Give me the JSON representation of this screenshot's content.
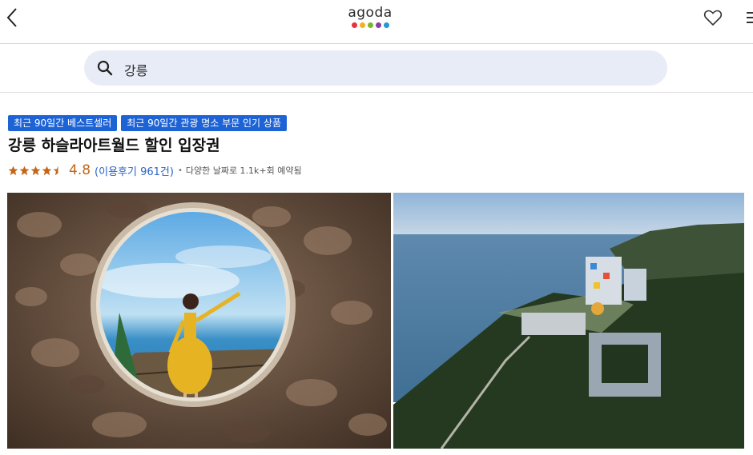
{
  "header": {
    "logo_text": "agoda",
    "logo_dot_colors": [
      "#e8323c",
      "#f3b21b",
      "#78b82a",
      "#8a3ea0",
      "#2299d6"
    ]
  },
  "search": {
    "value": "강릉"
  },
  "product": {
    "badges": [
      "최근 90일간 베스트셀러",
      "최근 90일간 관광 명소 부문 인기 상품"
    ],
    "title": "강릉 하슬라아트월드 할인 입장권",
    "rating": "4.8",
    "stars": 4.5,
    "reviews_label": "(이용후기 961건)",
    "bullet": "•",
    "booked_label": "다양한 날짜로 1.1k+회 예약됨"
  },
  "colors": {
    "badge_bg": "#1e63d6",
    "rating_orange": "#c2661b",
    "link_blue": "#2a63c8",
    "search_bg": "#e8ecf7"
  },
  "gallery": {
    "images": [
      "stone-circle-window-photo",
      "coastal-museum-aerial-photo"
    ]
  }
}
